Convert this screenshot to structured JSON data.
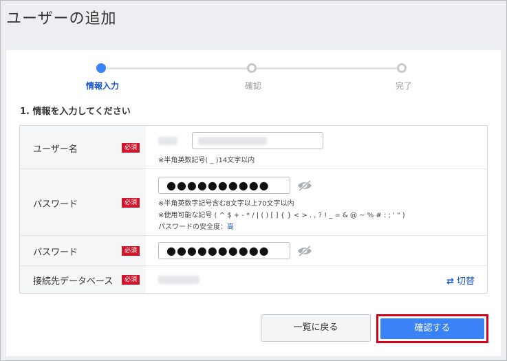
{
  "page": {
    "title": "ユーザーの追加"
  },
  "stepper": {
    "steps": [
      {
        "label": "情報入力",
        "state": "active"
      },
      {
        "label": "確認",
        "state": "pending"
      },
      {
        "label": "完了",
        "state": "pending"
      }
    ]
  },
  "section": {
    "title": "1. 情報を入力してください"
  },
  "form": {
    "required_label": "必須",
    "username": {
      "label": "ユーザー名",
      "hint": "※半角英数記号( _ )14文字以内"
    },
    "password": {
      "label": "パスワード",
      "value_masked": "●●●●●●●●●●",
      "hint_length": "※半角英数字記号含む8文字以上70文字以内",
      "hint_symbols": "※使用可能な記号 ( ^ $ + - * / | ( ) [ ] { } < > . , ? ! _ = & @ ~ % # : ; ' \" )",
      "strength_label": "パスワードの安全度：",
      "strength_value": "高"
    },
    "password_confirm": {
      "label": "パスワード",
      "value_masked": "●●●●●●●●●●"
    },
    "database": {
      "label": "接続先データベース",
      "switch_icon": "swap-arrows-icon",
      "switch_label": "切替"
    }
  },
  "buttons": {
    "back_label": "一覧に戻る",
    "confirm_label": "確認する"
  },
  "colors": {
    "accent": "#3b82f6",
    "required_badge": "#d0172b",
    "highlight_outline": "#d0021b",
    "link": "#1a56c9"
  }
}
